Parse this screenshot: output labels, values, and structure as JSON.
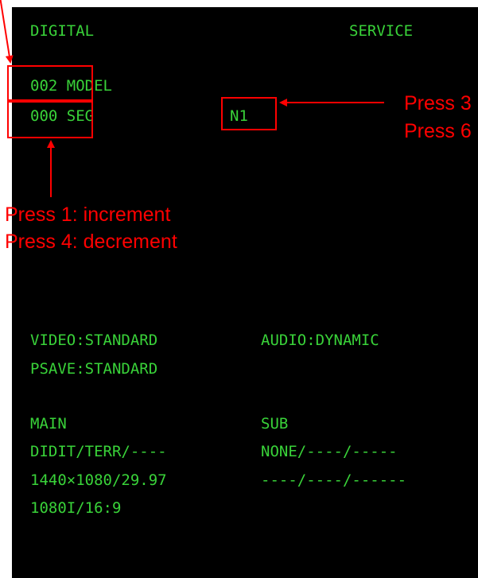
{
  "osd": {
    "header_left": "DIGITAL",
    "header_right": "SERVICE",
    "model_line": "002 MODEL",
    "seg_line": "000 SEG",
    "n_value": "N1",
    "video": "VIDEO:STANDARD",
    "audio": "AUDIO:DYNAMIC",
    "psave": "PSAVE:STANDARD",
    "main_label": "MAIN",
    "sub_label": "SUB",
    "main_source": "DIDIT/TERR/----",
    "sub_source": "NONE/----/-----",
    "main_resolution": "1440×1080/29.97",
    "sub_resolution": "----/----/------",
    "main_format": "1080I/16:9"
  },
  "annotations": {
    "left_line1": "Press 1: increment",
    "left_line2": "Press 4: decrement",
    "right_line1": "Press 3",
    "right_line2": "Press 6"
  },
  "colors": {
    "screen_bg": "#000000",
    "osd_text": "#39d239",
    "annotation": "#ff0000"
  }
}
